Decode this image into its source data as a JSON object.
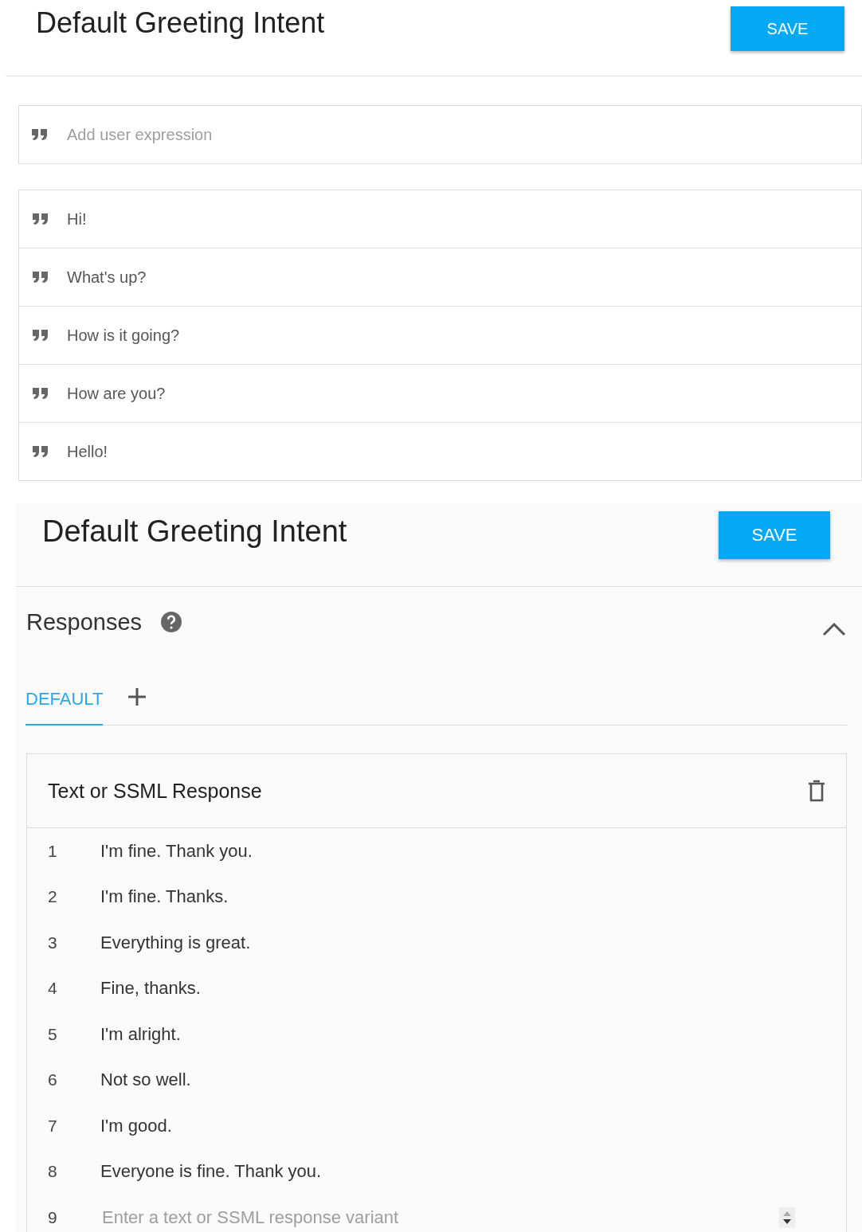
{
  "top_panel": {
    "title": "Default Greeting Intent",
    "save_button": "SAVE"
  },
  "training_phrases": {
    "placeholder": "Add user expression",
    "phrases": [
      "Hi!",
      "What's up?",
      "How is it going?",
      "How are you?",
      "Hello!"
    ]
  },
  "bottom_panel": {
    "title": "Default Greeting Intent",
    "save_button": "SAVE"
  },
  "responses": {
    "title": "Responses",
    "expanded": true,
    "tabs": [
      {
        "label": "DEFAULT",
        "selected": true
      }
    ],
    "card": {
      "title": "Text or SSML Response",
      "rows": [
        {
          "number": "1",
          "text": "I'm fine. Thank you."
        },
        {
          "number": "2",
          "text": "I'm fine. Thanks."
        },
        {
          "number": "3",
          "text": "Everything is great."
        },
        {
          "number": "4",
          "text": "Fine, thanks."
        },
        {
          "number": "5",
          "text": "I'm alright."
        },
        {
          "number": "6",
          "text": "Not so well."
        },
        {
          "number": "7",
          "text": "I'm good."
        },
        {
          "number": "8",
          "text": "Everyone is fine. Thank you."
        }
      ],
      "new_row": {
        "number": "9",
        "placeholder": "Enter a text or SSML response variant"
      }
    }
  }
}
